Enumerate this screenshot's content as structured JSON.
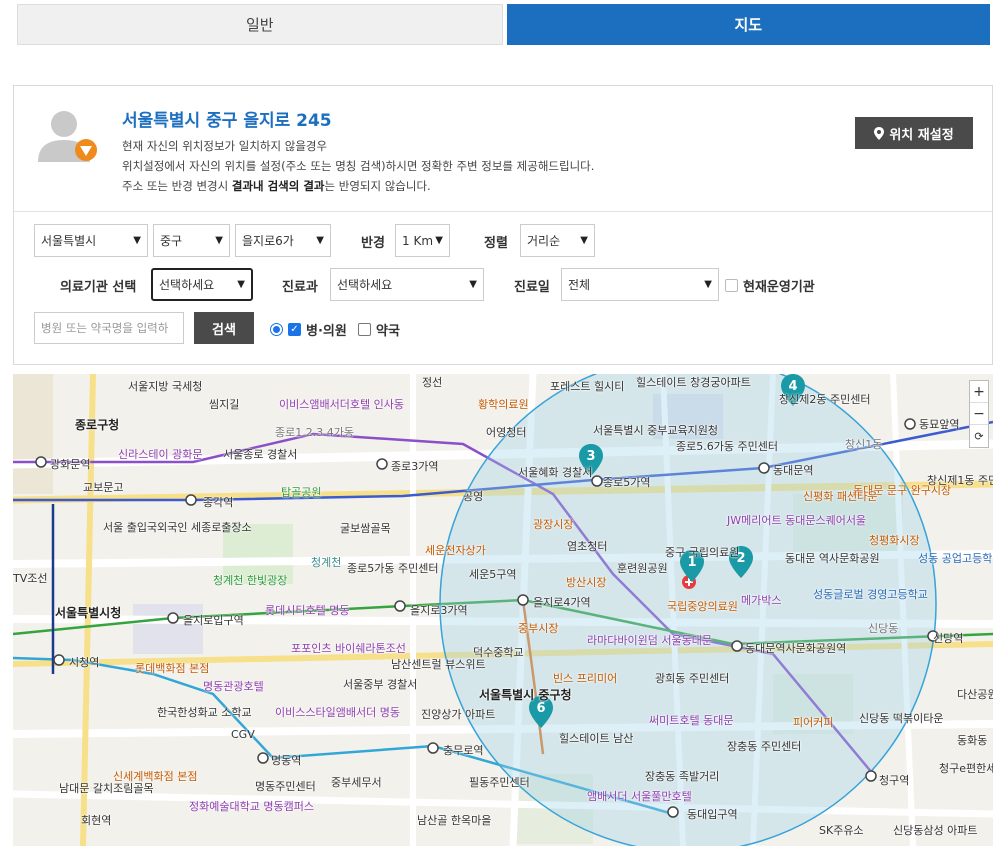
{
  "tabs": [
    {
      "label": "일반"
    },
    {
      "label": "지도"
    }
  ],
  "location": {
    "title": "서울특별시 중구 을지로 245",
    "desc1": "현재 자신의 위치정보가 일치하지 않을경우",
    "desc2": "위치설정에서 자신의 위치를 설정(주소 또는 명칭 검색)하시면 정확한 주변 정보를 제공해드립니다.",
    "desc3_pre": "주소 또는 반경 변경시 ",
    "desc3_bold": "결과내 검색의 결과",
    "desc3_post": "는 반영되지 않습니다.",
    "reset_label": "위치 재설정"
  },
  "filters": {
    "city": "서울특별시",
    "district": "중구",
    "dong": "을지로6가",
    "radius_label": "반경",
    "radius_value": "1 Km",
    "sort_label": "정렬",
    "sort_value": "거리순",
    "institution_label": "의료기관 선택",
    "institution_value": "선택하세요",
    "department_label": "진료과",
    "department_value": "선택하세요",
    "day_label": "진료일",
    "day_value": "전체",
    "open_now_label": "현재운영기관",
    "search_placeholder": "병원 또는 약국명을 입력하",
    "search_button": "검색",
    "hospital_label": "병·의원",
    "pharmacy_label": "약국"
  },
  "map": {
    "zoom_in": "+",
    "zoom_out": "−",
    "reset": "⟳",
    "pins": [
      "1",
      "2",
      "3",
      "4",
      "6"
    ],
    "labels": {
      "l1": "서울지방 국세청",
      "l2": "씸지길",
      "l3": "이비스앰배서더호텔 인사동",
      "l4": "정선",
      "l5": "황학의료원",
      "l6": "포레스트 힐시티",
      "l7": "힐스테이트 창경궁아파트",
      "l8": "창신제2동 주민센터",
      "l9": "동묘앞역",
      "l10": "종로구청",
      "l11": "신라스테이 광화문",
      "l12": "서울종로 경찰서",
      "l13": "종로1.2.3.4가동",
      "l14": "종로3가역",
      "l15": "어영청터",
      "l16": "서울특별시 중부교육지원청",
      "l17": "종로5.6가동",
      "l18": "종로5.6가동 주민센터",
      "l19": "창신1동",
      "l20": "광화문역",
      "l21": "교보문고",
      "l22": "탑골공원",
      "l23": "서울혜화 경찰서",
      "l24": "종로5가역",
      "l25": "동대문역",
      "l26": "동대문 문구 완구시장",
      "l27": "창신제1동 주민센터",
      "l28": "종각역",
      "l29": "서울 출입국외국인 세종로출장소",
      "l30": "굴보쌈골목",
      "l31": "공영",
      "l32": "광장시장",
      "l33": "신평화 패션타운",
      "l34": "JW메리어트 동대문스퀘어서울",
      "l35": "청평화시장",
      "l36": "세운전자상가",
      "l37": "염초청터",
      "l38": "청계천",
      "l39": "청계천 한빛광장",
      "l40": "종로5가동 주민센터",
      "l41": "세운5구역",
      "l42": "을지로동",
      "l43": "방산시장",
      "l44": "훈련원공원",
      "l45": "중구 국립의료원",
      "l46": "동대문 역사문화공원",
      "l47": "성동 공업고등학교",
      "l48": "TV조선",
      "l49": "서울특별시청",
      "l50": "을지로입구역",
      "l51": "롯데시티호텔 명동",
      "l52": "을지로3가역",
      "l53": "을지로4가역",
      "l54": "메가박스",
      "l55": "성동글로벌 경영고등학교",
      "l56": "국립중앙의료원",
      "l57": "신당동",
      "l58": "중부시장",
      "l59": "라마다바이윈덤 서울동대문",
      "l60": "신당역",
      "l61": "덕수중학교",
      "l62": "동대문역사문화공원역",
      "l63": "시청역",
      "l64": "롯데백화점 본점",
      "l65": "포포인츠 바이쉐라톤조선",
      "l66": "남산센트럴 뷰스위트",
      "l67": "빈스 프리미어",
      "l68": "광희동 주민센터",
      "l69": "명동관광호텔",
      "l70": "서울중부 경찰서",
      "l71": "서울특별시 중구청",
      "l72": "다산공원",
      "l73": "신당동 떡볶이타운",
      "l74": "한국한성화교 소학교",
      "l75": "이비스스타일앰배서더 명동",
      "l76": "진양상가 아파트",
      "l77": "힐스테이트 남산",
      "l78": "써미트호텔 동대문",
      "l79": "피어커피",
      "l80": "동화동",
      "l81": "CGV",
      "l82": "명동역",
      "l83": "충무로역",
      "l84": "장충동 주민센터",
      "l85": "신세계백화점 본점",
      "l86": "명동주민센터",
      "l87": "중부세무서",
      "l88": "필동주민센터",
      "l89": "장충동 족발거리",
      "l90": "청구역",
      "l91": "청구e편한세상 아파트",
      "l92": "남대문 갈치조림골목",
      "l93": "정화예술대학교 명동캠퍼스",
      "l94": "앰배서더 서울풀만호텔",
      "l95": "동대입구역",
      "l96": "SK주유소",
      "l97": "신당동삼성 아파트",
      "l98": "회현역",
      "l99": "남산골 한옥마을",
      "l100": "서울의",
      "l101": "남대문",
      "l102": "국민",
      "l103": "의료원",
      "l104": "성동구"
    }
  },
  "colors": {
    "accent": "#1c6fbf",
    "button_dark": "#4a4a4a",
    "radius_fill": "#9fd0e8"
  }
}
